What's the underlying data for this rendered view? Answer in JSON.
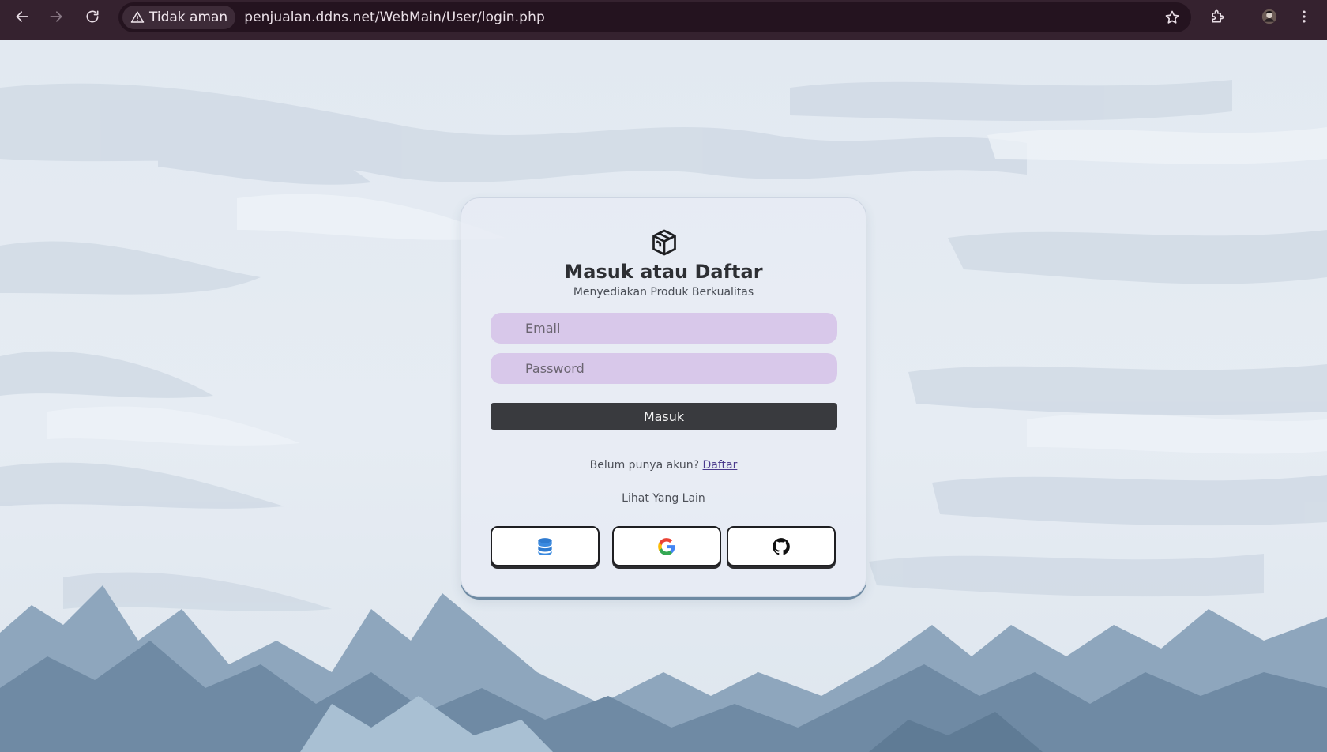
{
  "browser": {
    "security_label": "Tidak aman",
    "url": "penjualan.ddns.net/WebMain/User/login.php",
    "icons": [
      "back-icon",
      "forward-icon",
      "reload-icon",
      "warning-icon",
      "star-icon",
      "extensions-icon",
      "avatar",
      "menu-icon"
    ]
  },
  "login": {
    "title": "Masuk atau Daftar",
    "subtitle": "Menyediakan Produk Berkualitas",
    "email_placeholder": "Email",
    "password_placeholder": "Password",
    "submit_label": "Masuk",
    "signup_prompt": "Belum punya akun?",
    "signup_link": "Daftar",
    "other_label": "Lihat Yang Lain",
    "social_buttons": [
      "database-icon",
      "google-icon",
      "github-icon"
    ]
  },
  "colors": {
    "chrome": "#35222f",
    "input_bg": "#d8c8ea",
    "button_bg": "#393a3e",
    "link": "#4a3a8c"
  }
}
